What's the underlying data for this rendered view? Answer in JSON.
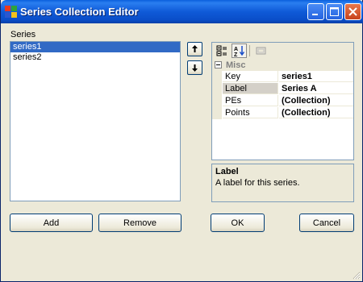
{
  "window": {
    "title": "Series Collection Editor"
  },
  "series_panel": {
    "label": "Series",
    "items": [
      {
        "label": "series1",
        "selected": true
      },
      {
        "label": "series2",
        "selected": false
      }
    ]
  },
  "buttons": {
    "add": "Add",
    "remove": "Remove",
    "ok": "OK",
    "cancel": "Cancel"
  },
  "property_grid": {
    "category": "Misc",
    "properties": [
      {
        "name": "Key",
        "value": "series1",
        "selected": false
      },
      {
        "name": "Label",
        "value": "Series A",
        "selected": true
      },
      {
        "name": "PEs",
        "value": "(Collection)",
        "selected": false
      },
      {
        "name": "Points",
        "value": "(Collection)",
        "selected": false
      }
    ]
  },
  "help": {
    "title": "Label",
    "description": "A label for this series."
  },
  "colors": {
    "titlebar": "#0a5fdc",
    "selection": "#316ac5",
    "window_bg": "#ece9d8"
  }
}
